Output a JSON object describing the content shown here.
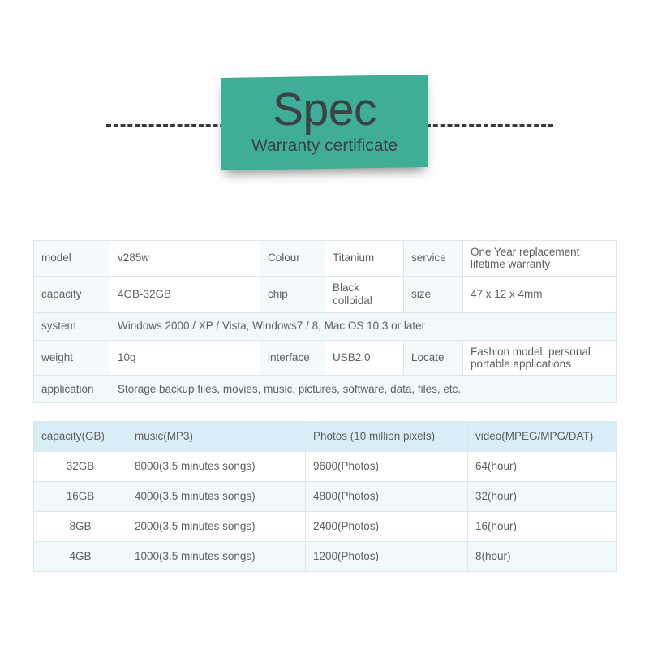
{
  "banner": {
    "title": "Spec",
    "subtitle": "Warranty certificate",
    "color": "#3fae96",
    "text_color": "#3c4244"
  },
  "decoration": {
    "dash_color": "#3a3a3a"
  },
  "spec_table": {
    "rows": [
      {
        "type": "pairs",
        "cells": [
          {
            "label": "model",
            "value": "v285w"
          },
          {
            "label": "Colour",
            "value": "Titanium"
          },
          {
            "label": "service",
            "value": "One Year replacement lifetime warranty"
          }
        ]
      },
      {
        "type": "pairs",
        "cells": [
          {
            "label": "capacity",
            "value": "4GB-32GB"
          },
          {
            "label": "chip",
            "value": "Black colloidal"
          },
          {
            "label": "size",
            "value": "47 x 12 x 4mm"
          }
        ]
      },
      {
        "type": "full",
        "label": "system",
        "value": "Windows 2000 / XP / Vista, Windows7 / 8, Mac OS 10.3 or later"
      },
      {
        "type": "pairs",
        "cells": [
          {
            "label": "weight",
            "value": "10g"
          },
          {
            "label": "interface",
            "value": "USB2.0"
          },
          {
            "label": "Locate",
            "value": "Fashion model, personal portable applications"
          }
        ]
      },
      {
        "type": "full",
        "label": "application",
        "value": "Storage backup files, movies, music, pictures, software, data, files, etc."
      }
    ]
  },
  "capacity_table": {
    "headers": [
      "capacity(GB)",
      "music(MP3)",
      "Photos (10 million pixels)",
      "video(MPEG/MPG/DAT)"
    ],
    "rows": [
      [
        "32GB",
        "8000(3.5 minutes songs)",
        "9600(Photos)",
        "64(hour)"
      ],
      [
        "16GB",
        "4000(3.5 minutes songs)",
        "4800(Photos)",
        "32(hour)"
      ],
      [
        "8GB",
        "2000(3.5 minutes songs)",
        "2400(Photos)",
        "16(hour)"
      ],
      [
        "4GB",
        "1000(3.5 minutes songs)",
        "1200(Photos)",
        "8(hour)"
      ]
    ],
    "header_bg": "#d9edf7"
  }
}
